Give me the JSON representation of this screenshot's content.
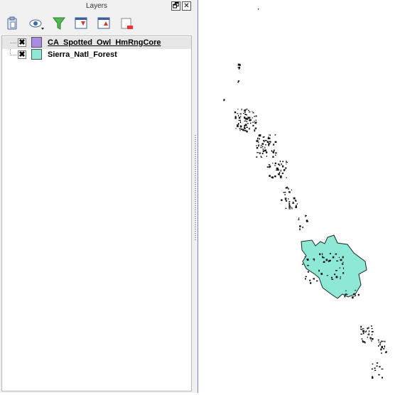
{
  "panel": {
    "title": "Layers",
    "float_glyph": "🗗",
    "close_glyph": "✕"
  },
  "toolbar": {
    "buttons": [
      {
        "name": "add-group",
        "icon": "clipboard-icon"
      },
      {
        "name": "manage-visibility",
        "icon": "eye-icon"
      },
      {
        "name": "filter-legend",
        "icon": "funnel-icon"
      },
      {
        "name": "expand-all",
        "icon": "expand-all-icon"
      },
      {
        "name": "collapse-all",
        "icon": "collapse-all-icon"
      },
      {
        "name": "remove-layer",
        "icon": "remove-layer-icon"
      }
    ]
  },
  "layers": [
    {
      "name": "CA_Spotted_Owl_HmRngCore",
      "checked": "✖",
      "color": "#a98be6",
      "selected": true
    },
    {
      "name": "Sierra_Natl_Forest",
      "checked": "✖",
      "color": "#8de8d6",
      "selected": false
    }
  ],
  "map": {
    "forest_fill": "#8de8d6",
    "point_color": "#111111",
    "outline_color": "#222222"
  }
}
